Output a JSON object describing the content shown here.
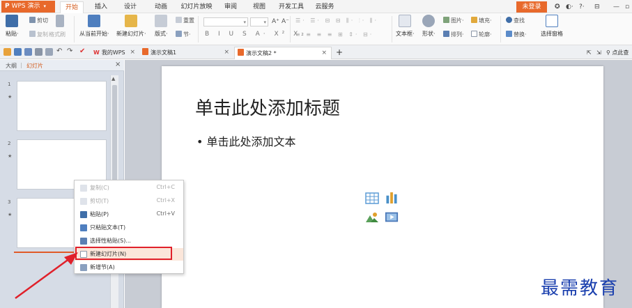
{
  "app": {
    "name": "WPS 演示"
  },
  "menu": {
    "tabs": [
      "开始",
      "插入",
      "设计",
      "动画",
      "幻灯片放映",
      "审阅",
      "视图",
      "开发工具",
      "云服务"
    ],
    "active": "开始",
    "login": "未登录",
    "right_help": "?·"
  },
  "ribbon": {
    "paste": "粘贴·",
    "cut": "剪切",
    "copy": "复制",
    "format_painter": "格式刷",
    "from_current": "从当前开始·",
    "new_slide": "新建幻灯片·",
    "layout": "版式·",
    "section": "节·",
    "reset": "重置",
    "font_buttons": "B I U S A· X² X₂",
    "text_box": "文本框·",
    "shape": "形状·",
    "picture": "图片·",
    "fill": "填充·",
    "arrange": "排列·",
    "outline": "轮廓·",
    "find": "查找",
    "replace": "替换·",
    "select_pane": "选择窗格"
  },
  "doc_tabs": [
    {
      "label": "我的WPS"
    },
    {
      "label": "演示文稿1"
    },
    {
      "label": "演示文稿2 *"
    }
  ],
  "toolbar_right": {
    "search": "点此查"
  },
  "left_pane": {
    "tabs": [
      "大纲",
      "幻灯片"
    ],
    "active": "幻灯片",
    "close": "×",
    "slides": [
      {
        "num": "1",
        "star": "★"
      },
      {
        "num": "2",
        "star": "★"
      },
      {
        "num": "3",
        "star": "★"
      }
    ]
  },
  "slide": {
    "title_placeholder": "单击此处添加标题",
    "body_placeholder": "• 单击此处添加文本"
  },
  "context_menu": {
    "items": [
      {
        "label": "复制(C)",
        "shortcut": "Ctrl+C",
        "disabled": true
      },
      {
        "label": "剪切(T)",
        "shortcut": "Ctrl+X",
        "disabled": true
      },
      {
        "label": "粘贴(P)",
        "shortcut": "Ctrl+V",
        "disabled": false
      },
      {
        "label": "只粘贴文本(T)",
        "shortcut": "",
        "disabled": false
      },
      {
        "label": "选择性粘贴(S)...",
        "shortcut": "",
        "disabled": false
      },
      {
        "label": "新建幻灯片(N)",
        "shortcut": "",
        "disabled": false
      },
      {
        "label": "新增节(A)",
        "shortcut": "",
        "disabled": false
      }
    ]
  },
  "watermark": "最需教育",
  "colors": {
    "accent": "#e8692b",
    "highlight_box": "#e0202a",
    "watermark": "#1a3fae"
  }
}
